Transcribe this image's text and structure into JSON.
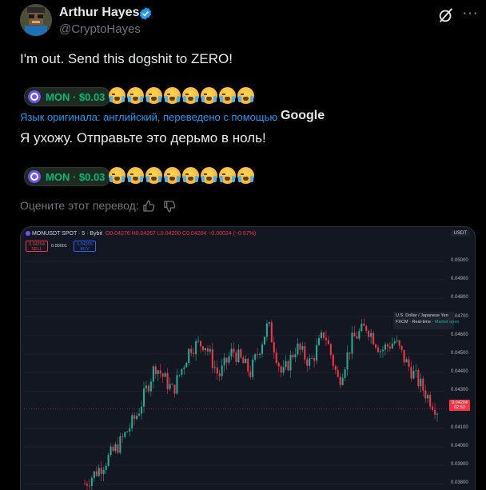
{
  "author": {
    "name": "Arthur Hayes",
    "handle": "@CryptoHayes"
  },
  "tweet": {
    "original": "I'm out. Send this dogshit to ZERO!",
    "translated": "Я ухожу. Отправьте это дерьмо в ноль!",
    "cashtag_label": "MON · $0.03",
    "translation_note": "Язык оригинала: английский, переведено с помощью",
    "translation_provider": "Google",
    "rate_prompt": "Оцените этот перевод:"
  },
  "icons": [
    "verified-badge-icon",
    "grok-icon",
    "more-icon",
    "token-coin-icon",
    "loudly-crying-face-emoji",
    "thumbs-up-icon",
    "thumbs-down-icon"
  ],
  "colors": {
    "background": "#000000",
    "accent": "#1d9bf0",
    "token_green": "#00ba7c",
    "chart_bg": "#131722",
    "candle_up": "#22ab94",
    "candle_down": "#f23645"
  },
  "chart": {
    "title": "MONUSDT SPOT · 5 · Bybit",
    "ohlc": "O0.04276 H0.04267 L0.04200 C0.04204 −0.00024 (−0.57%)",
    "sell_price": "0.04204",
    "sell_label": "SELL",
    "spread": "0.00001",
    "buy_price": "0.04205",
    "buy_label": "BUY",
    "currency": "USDT",
    "current_price": "0.04204",
    "current_time": "02:52",
    "tooltip_line1": "U.S. Dollar / Japanese Yen",
    "tooltip_line2_a": "FXCM · Real-time ·",
    "tooltip_line2_b": "Market open"
  },
  "chart_data": {
    "type": "candlestick",
    "y_ticks": [
      "0.05000",
      "0.04900",
      "0.04800",
      "0.04700",
      "0.04600",
      "0.04500",
      "0.04400",
      "0.04300",
      "0.04100",
      "0.04000",
      "0.03900",
      "0.03800"
    ],
    "ylim": [
      0.0378,
      0.0503
    ]
  }
}
